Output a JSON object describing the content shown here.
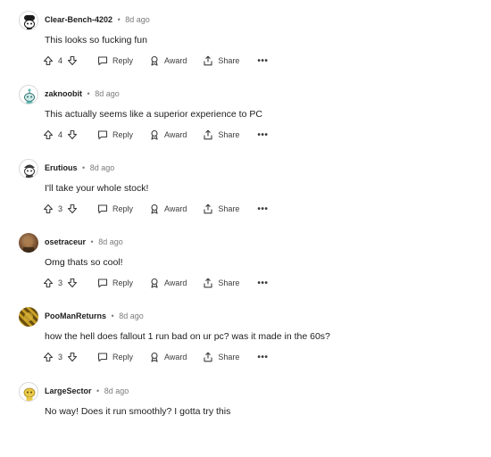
{
  "comments": [
    {
      "username": "Clear-Bench-4202",
      "time": "8d ago",
      "text": "This looks so fucking fun",
      "score": "4",
      "avatar_icon": "snoo-black-beanie-avatar",
      "avatar_color": "#1a1a1b"
    },
    {
      "username": "zaknoobit",
      "time": "8d ago",
      "text": "This actually seems like a superior experience to PC",
      "score": "4",
      "avatar_icon": "snoo-teal-avatar",
      "avatar_color": "#5fb7b3"
    },
    {
      "username": "Erutious",
      "time": "8d ago",
      "text": "I'll take your whole stock!",
      "score": "3",
      "avatar_icon": "snoo-dark-avatar",
      "avatar_color": "#3a3a3a"
    },
    {
      "username": "osetraceur",
      "time": "8d ago",
      "text": "Omg thats so cool!",
      "score": "3",
      "avatar_icon": "photo-avatar",
      "avatar_color": "#6b4a2e"
    },
    {
      "username": "PooManReturns",
      "time": "8d ago",
      "text": "how the hell does fallout 1 run bad on ur pc? was it made in the 60s?",
      "score": "3",
      "avatar_icon": "gold-pattern-avatar",
      "avatar_color": "#8a6a12"
    },
    {
      "username": "LargeSector",
      "time": "8d ago",
      "text": "No way! Does it run smoothly? I gotta try this",
      "score": "",
      "avatar_icon": "snoo-yellow-avatar",
      "avatar_color": "#e8c94a"
    }
  ],
  "actions": {
    "reply_label": "Reply",
    "award_label": "Award",
    "share_label": "Share",
    "more_label": "•••"
  },
  "separator": "•"
}
